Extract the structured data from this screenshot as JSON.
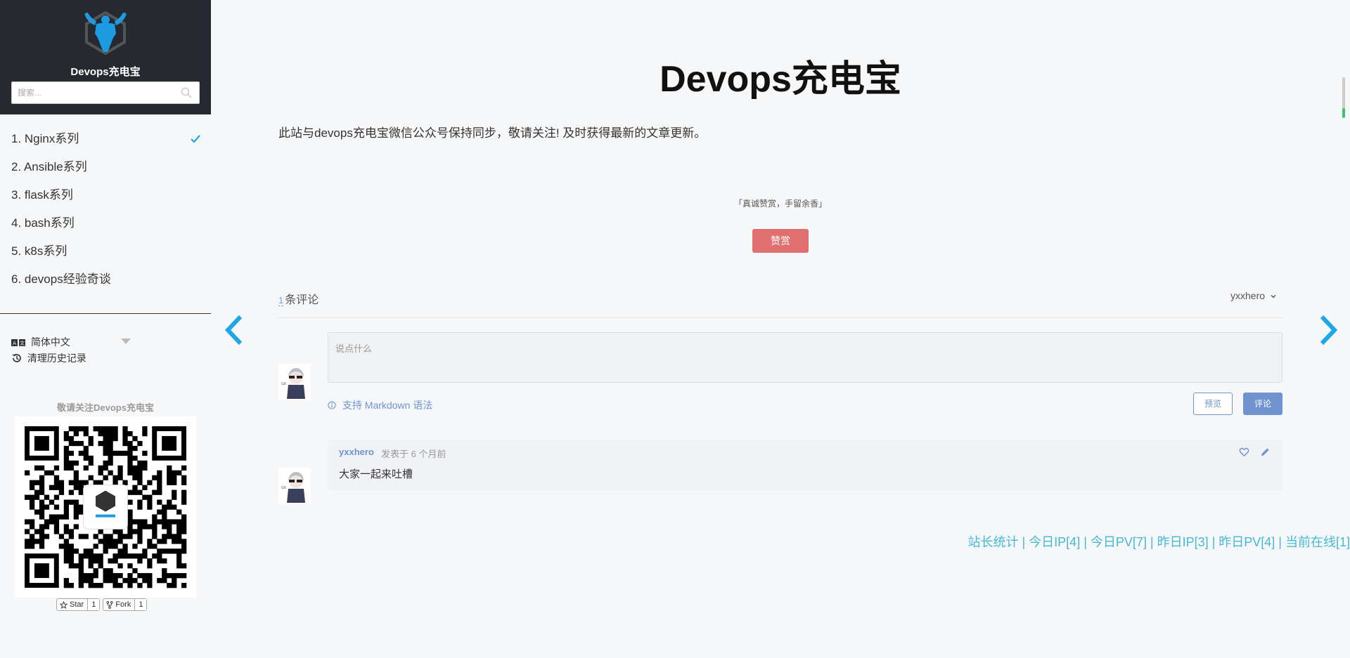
{
  "site": {
    "name": "Devops充电宝"
  },
  "search": {
    "placeholder": "搜索..."
  },
  "toc": {
    "items": [
      {
        "label": "1. Nginx系列"
      },
      {
        "label": "2. Ansible系列"
      },
      {
        "label": "3. flask系列"
      },
      {
        "label": "4. bash系列"
      },
      {
        "label": "5. k8s系列"
      },
      {
        "label": "6. devops经验奇谈"
      }
    ]
  },
  "language": {
    "selected": "简体中文"
  },
  "history": {
    "label": "清理历史记录"
  },
  "follow": {
    "text": "敬请关注Devops充电宝"
  },
  "github": {
    "star_label": "Star",
    "star_count": "1",
    "fork_label": "Fork",
    "fork_count": "1"
  },
  "page": {
    "title": "Devops充电宝",
    "intro": "此站与devops充电宝微信公众号保持同步，敬请关注! 及时获得最新的文章更新。",
    "reward_text": "「真诚赞赏，手留余香」",
    "reward_button": "赞赏"
  },
  "comments": {
    "count": "1",
    "count_suffix": "条评论",
    "user": "yxxhero",
    "placeholder": "说点什么",
    "markdown_hint": "支持 Markdown 语法",
    "preview_button": "预览",
    "submit_button": "评论",
    "list": [
      {
        "author": "yxxhero",
        "meta": "发表于  6 个月前",
        "text": "大家一起来吐槽"
      }
    ]
  },
  "footer": {
    "stats": "站长统计 | 今日IP[4] | 今日PV[7] | 昨日IP[3] | 昨日PV[4] | 当前在线[1]"
  },
  "colors": {
    "sidebar_header": "#262a30",
    "accent": "#1da7e6",
    "reward": "#e07070",
    "comment_accent": "#6e93cf",
    "stats": "#44b9d6"
  },
  "icons": [
    "logo-icon",
    "search-icon",
    "check-icon",
    "translate-icon",
    "history-icon",
    "qr-code",
    "star-icon",
    "fork-icon",
    "chevron-left-icon",
    "chevron-right-icon",
    "chevron-down-icon",
    "info-icon",
    "heart-icon",
    "edit-icon"
  ]
}
